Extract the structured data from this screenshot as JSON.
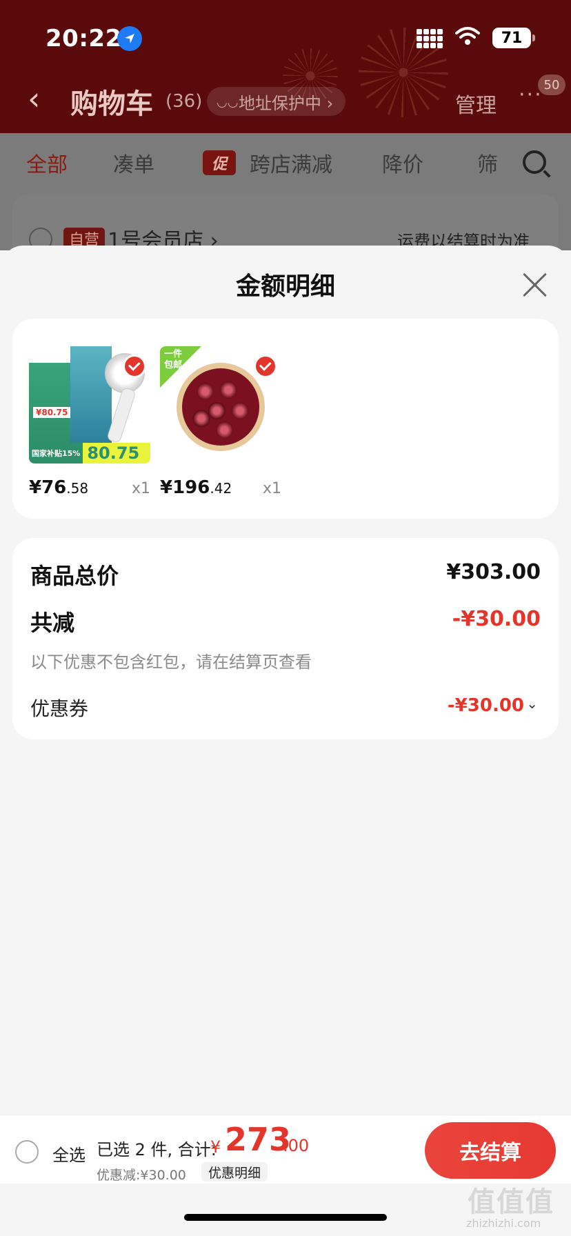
{
  "status_bar": {
    "time": "20:22",
    "battery": "71"
  },
  "header": {
    "back_icon": "chevron-left-icon",
    "title": "购物车",
    "count": "(36)",
    "address_pill": "地址保护中 ›",
    "manage": "管理",
    "more": "···",
    "more_badge": "50"
  },
  "tabs": [
    {
      "label": "全部",
      "active": true
    },
    {
      "label": "凑单"
    },
    {
      "label": "促",
      "tag": true
    },
    {
      "label": "跨店满减"
    },
    {
      "label": "降价"
    },
    {
      "label": "筛"
    }
  ],
  "store": {
    "tag": "自营",
    "name": "1号会员店 ›",
    "shipping_note": "运费以结算时为准"
  },
  "sheet": {
    "title": "金额明细",
    "items": [
      {
        "price_int": "¥76",
        "price_dec": ".58",
        "qty": "x1",
        "thumb_text": "80.75",
        "thumb_label": "国家补贴15%",
        "mini_price": "¥80.75"
      },
      {
        "price_int": "¥196",
        "price_dec": ".42",
        "qty": "x1",
        "badge": "一件\n包邮"
      }
    ],
    "summary": {
      "total_label": "商品总价",
      "total_value": "¥303.00",
      "reduce_label": "共减",
      "reduce_value": "-¥30.00",
      "note": "以下优惠不包含红包，请在结算页查看",
      "coupon_label": "优惠券",
      "coupon_value": "-¥30.00"
    }
  },
  "bottom_bar": {
    "select_all": "全选",
    "selected": "已选 2 件, 合计:",
    "currency": "¥",
    "total_int": "273",
    "total_dec": ".00",
    "discount": "优惠减:¥30.00",
    "detail_link": "优惠明细",
    "checkout": "去结算"
  },
  "watermark": {
    "main": "值值值",
    "sub": "zhizhizhi.com"
  },
  "colors": {
    "accent": "#e4352b",
    "header_bg": "#5a0a0a"
  }
}
